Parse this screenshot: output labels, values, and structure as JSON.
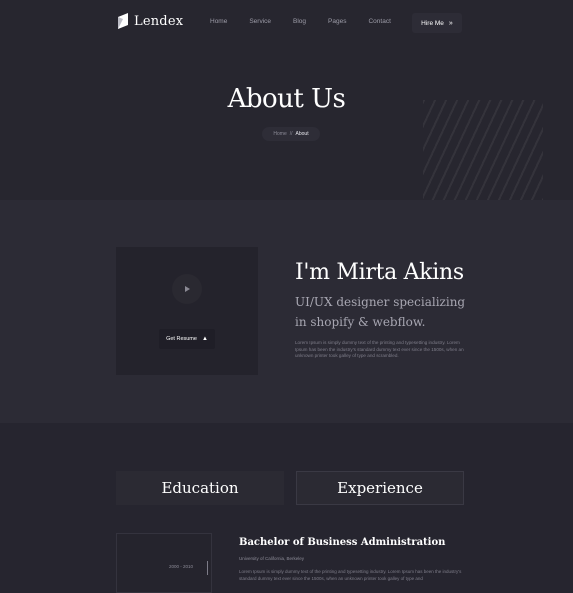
{
  "brand": {
    "name": "Lendex"
  },
  "nav": {
    "items": [
      "Home",
      "Service",
      "Blog",
      "Pages",
      "Contact"
    ],
    "hire_label": "Hire Me",
    "hire_arrow": "»"
  },
  "hero": {
    "title": "About Us",
    "breadcrumb": {
      "home": "Home",
      "separator": "//",
      "current": "About"
    }
  },
  "about": {
    "resume_button": "Get Resume",
    "resume_icon": "▲",
    "name": "I'm Mirta Akins",
    "tagline": "UI/UX designer specializing in shopify & webflow.",
    "bio": "Lorem Ipsum is simply dummy text of the printing and typesetting industry. Lorem Ipsum has been the industry's standard dummy text ever since the 1500s, when an unknown printer took galley of type and scrambled."
  },
  "resume": {
    "tabs": [
      "Education",
      "Experience"
    ],
    "education": {
      "years": "2000 - 2010",
      "degree": "Bachelor of Business Administration",
      "school": "University of California, Berkeley",
      "description": "Lorem Ipsum is simply dummy text of the printing and typesetting industry. Lorem Ipsum has been the industry's standard dummy text ever since the 1500s, when an unknown printer took galley of type and"
    }
  },
  "colors": {
    "background": "#26252f",
    "section": "#2c2b35",
    "text": "#ffffff",
    "muted": "#8d8c98"
  }
}
